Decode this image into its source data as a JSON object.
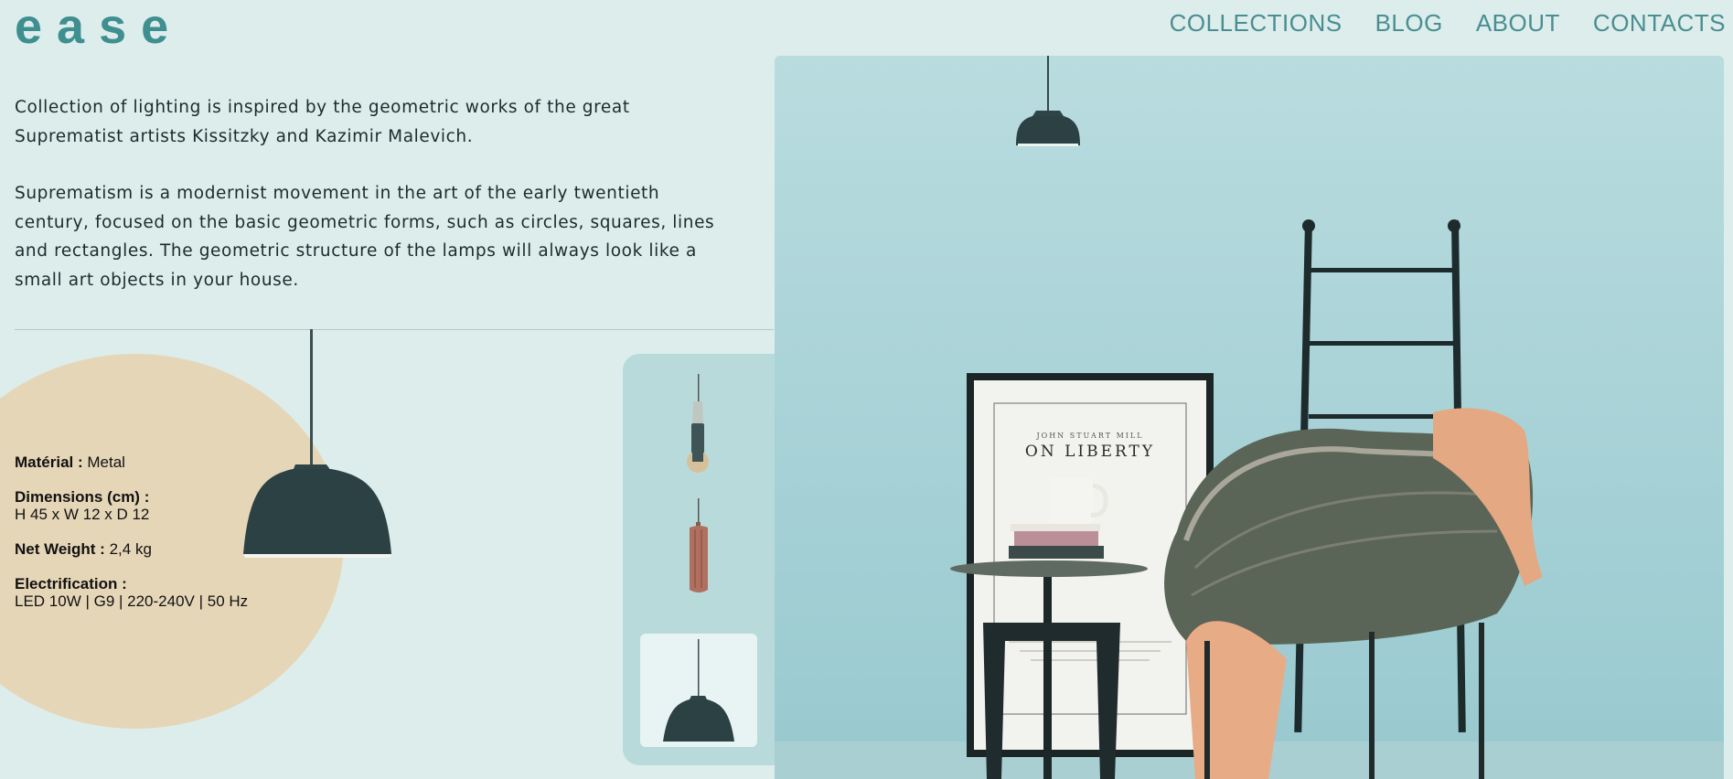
{
  "brand": {
    "logo": "ease"
  },
  "nav": {
    "items": [
      "COLLECTIONS",
      "BLOG",
      "ABOUT",
      "CONTACTS"
    ]
  },
  "intro": {
    "p1": "Collection of lighting is inspired by the geometric works of the great Suprematist artists Kissitzky and Kazimir Malevich.",
    "p2": "Suprematism is a modernist movement in the art of the early twentieth century, focused on the basic geometric forms, such as circles, squares, lines and rectangles. The geometric structure of the lamps will always look like a small art objects in your house."
  },
  "specs": {
    "material_label": "Matérial :",
    "material_value": "Metal",
    "dimensions_label": "Dimensions (cm) :",
    "dimensions_value": "H 45 x W 12 x D 12",
    "weight_label": "Net Weight :",
    "weight_value": "2,4 kg",
    "electrification_label": "Electrification :",
    "electrification_value": "LED 10W | G9 | 220-240V | 50 Hz"
  },
  "thumbnails": {
    "items": [
      "grey-cylinder-pendant",
      "copper-ribbed-pendant",
      "dark-teal-dome-pendant"
    ],
    "selected_index": 2
  },
  "photo": {
    "poster_author": "JOHN STUART MILL",
    "poster_title": "ON LIBERTY"
  },
  "colors": {
    "background": "#dcedec",
    "brand_teal": "#3f8f90",
    "circle_beige": "#e6d6b8",
    "lamp_dark": "#2b4143"
  }
}
